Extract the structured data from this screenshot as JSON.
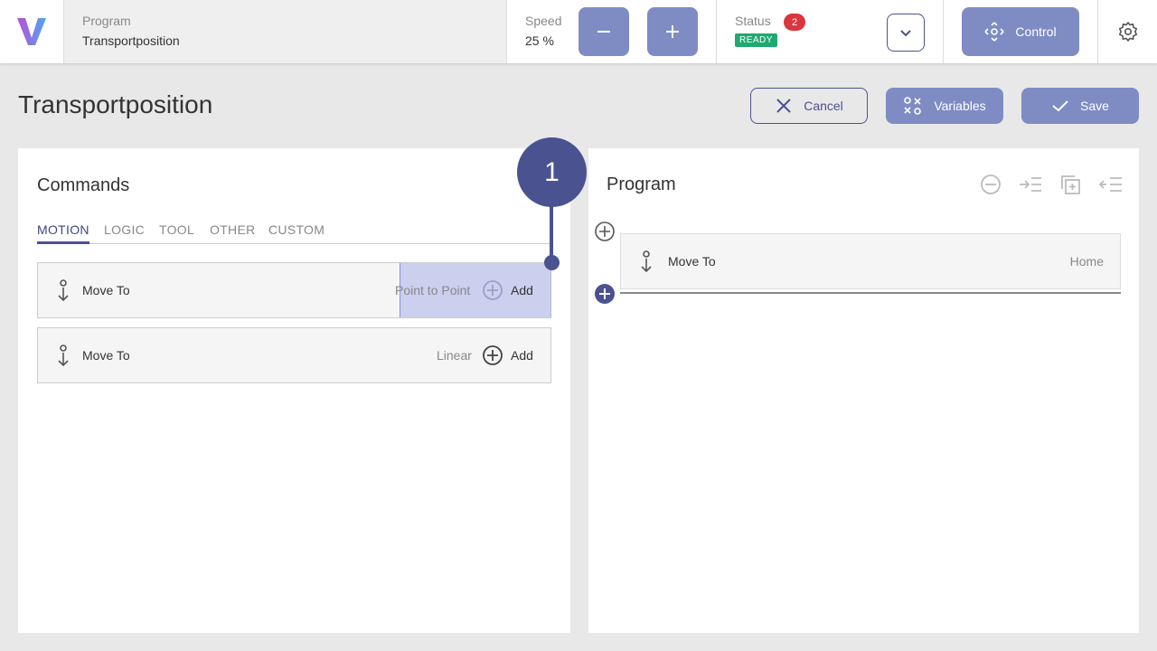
{
  "header": {
    "program_label": "Program",
    "program_value": "Transportposition",
    "speed_label": "Speed",
    "speed_value": "25 %",
    "status_label": "Status",
    "status_count": "2",
    "status_value": "READY",
    "control_label": "Control"
  },
  "page": {
    "title": "Transportposition",
    "cancel_label": "Cancel",
    "variables_label": "Variables",
    "save_label": "Save"
  },
  "commands": {
    "title": "Commands",
    "tabs": [
      "MOTION",
      "LOGIC",
      "TOOL",
      "OTHER",
      "CUSTOM"
    ],
    "active_tab": "MOTION",
    "items": [
      {
        "label": "Move To",
        "type": "Point to Point",
        "add": "Add"
      },
      {
        "label": "Move To",
        "type": "Linear",
        "add": "Add"
      }
    ]
  },
  "marker": {
    "number": "1"
  },
  "program": {
    "title": "Program",
    "items": [
      {
        "label": "Move To",
        "target": "Home"
      }
    ]
  },
  "colors": {
    "primary": "#4a5290",
    "button_fill": "#7f8cc4",
    "status_ready": "#1fa971",
    "badge_red": "#d9363e"
  }
}
